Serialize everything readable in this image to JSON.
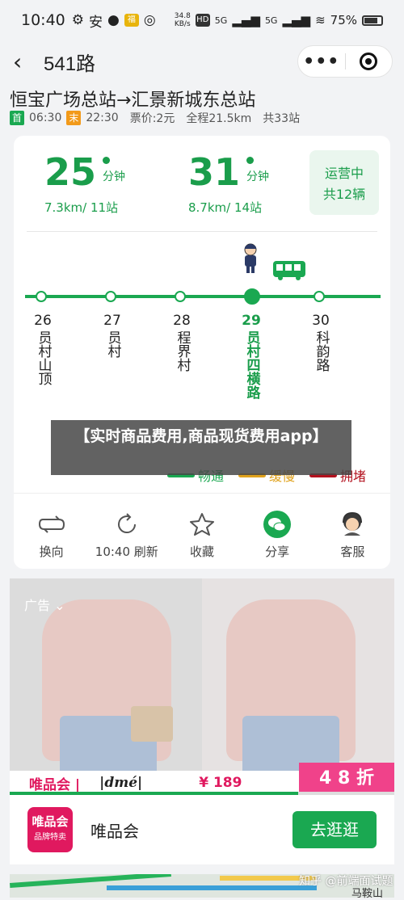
{
  "status": {
    "time": "10:40",
    "net_speed_top": "34.8",
    "net_speed_bottom": "KB/s",
    "hd": "HD",
    "sig1": "5G",
    "sig2": "5G",
    "battery": "75%"
  },
  "nav": {
    "title": "541路",
    "back_icon": "‹",
    "more_icon": "•••"
  },
  "route": {
    "name": "恒宝广场总站→汇景新城东总站",
    "first_tag": "首",
    "first_time": "06:30",
    "last_tag": "末",
    "last_time": "22:30",
    "fare": "票价:2元",
    "distance": "全程21.5km",
    "stops": "共33站"
  },
  "arrivals": [
    {
      "minutes": "25",
      "unit": "分钟",
      "detail": "7.3km/ 11站"
    },
    {
      "minutes": "31",
      "unit": "分钟",
      "detail": "8.7km/ 14站"
    }
  ],
  "operating": {
    "line1": "运营中",
    "line2": "共12辆"
  },
  "stations": [
    {
      "num": "26",
      "name": "员村山顶"
    },
    {
      "num": "27",
      "name": "员村"
    },
    {
      "num": "28",
      "name": "程界村"
    },
    {
      "num": "29",
      "name": "员村四横路"
    },
    {
      "num": "30",
      "name": "科韵路"
    }
  ],
  "legend": [
    {
      "label": "畅通",
      "color": "#1aa851"
    },
    {
      "label": "缓慢",
      "color": "#e0a21c"
    },
    {
      "label": "拥堵",
      "color": "#b3111e"
    }
  ],
  "actions": [
    {
      "label": "换向",
      "icon": "swap-icon"
    },
    {
      "label": "10:40 刷新",
      "icon": "refresh-icon"
    },
    {
      "label": "收藏",
      "icon": "star-icon"
    },
    {
      "label": "分享",
      "icon": "wechat-icon"
    },
    {
      "label": "客服",
      "icon": "customer-service-icon"
    }
  ],
  "overlay": {
    "text": "【实时商品费用,商品现货费用app】"
  },
  "ad": {
    "label": "广告 ⌄",
    "brand_text": "唯品会 |",
    "dme": "|dmé|",
    "price": "¥ 189",
    "promo": "4 8 折",
    "progress": 0.75
  },
  "brand": {
    "logo_main": "唯品会",
    "logo_sub": "品牌特卖",
    "name": "唯品会",
    "button": "去逛逛"
  },
  "watermark": "知乎 @前端面试题",
  "map_label": "马鞍山"
}
